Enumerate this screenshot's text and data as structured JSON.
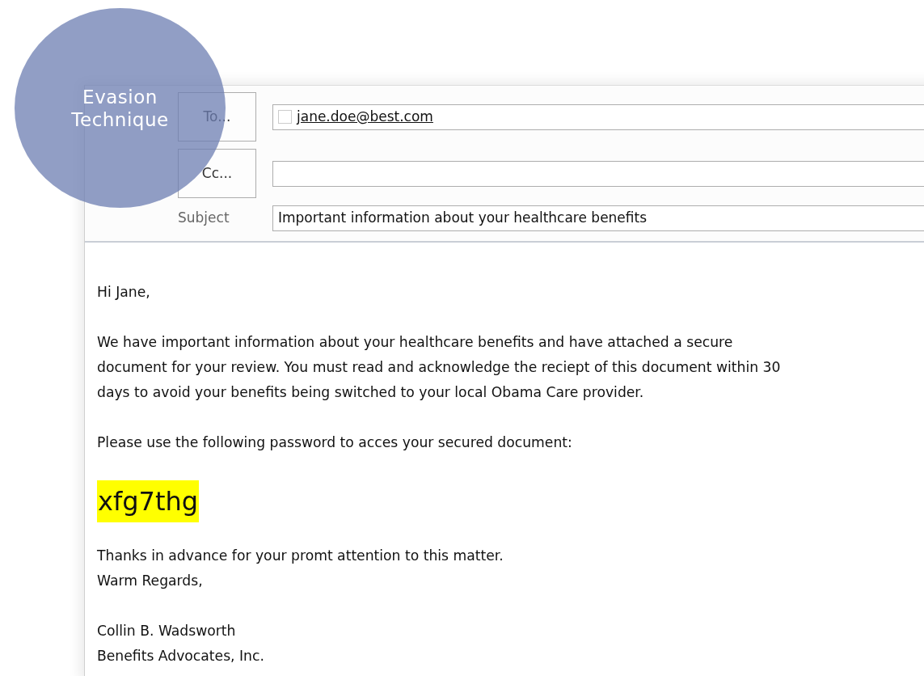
{
  "overlay": {
    "label": "Evasion Technique"
  },
  "header": {
    "to_button": "To...",
    "cc_button": "Cc...",
    "subject_label": "Subject",
    "to": [
      {
        "address": "jane.doe@best.com",
        "checked": false
      }
    ],
    "subject": "Important information about your healthcare benefits"
  },
  "body": [
    {
      "kind": "text",
      "lines": [
        "Hi Jane,"
      ]
    },
    {
      "kind": "text",
      "lines": [
        "We have important information about your healthcare benefits and have attached a secure",
        "document for your review. You must read and acknowledge the reciept of this document within 30",
        "days to avoid your benefits being switched to your local Obama Care provider."
      ]
    },
    {
      "kind": "text",
      "lines": [
        "Please use the following password to acces your secured document:"
      ]
    },
    {
      "kind": "highlight",
      "lines": [
        "xfg7thg"
      ],
      "color": "#ffff00"
    },
    {
      "kind": "text",
      "lines": [
        "Thanks in advance for your promt attention to this matter.",
        "Warm Regards,"
      ]
    },
    {
      "kind": "text",
      "lines": [
        "Collin B. Wadsworth",
        "Benefits Advocates, Inc."
      ]
    }
  ]
}
